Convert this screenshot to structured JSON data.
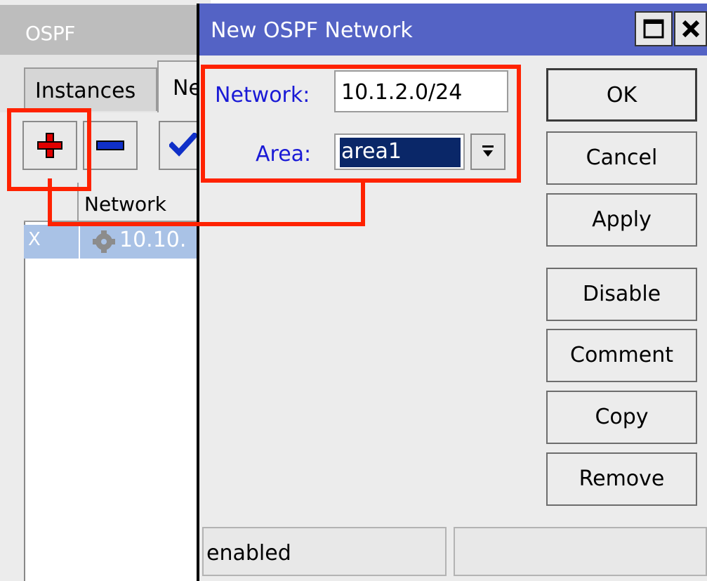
{
  "background_window": {
    "title": "OSPF",
    "tabs": [
      {
        "label": "Instances"
      },
      {
        "label": "Ne"
      }
    ],
    "toolbar": {
      "add_icon": "plus-icon",
      "remove_icon": "minus-icon",
      "enable_icon": "checkmark-icon"
    },
    "table": {
      "columns": [
        "",
        "Network"
      ],
      "rows": [
        {
          "flag": "X",
          "icon": "gear-icon",
          "network": "10.10."
        }
      ]
    }
  },
  "dialog": {
    "title": "New OSPF Network",
    "fields": {
      "network_label": "Network:",
      "network_value": "10.1.2.0/24",
      "area_label": "Area:",
      "area_value": "area1"
    },
    "buttons": {
      "ok": "OK",
      "cancel": "Cancel",
      "apply": "Apply",
      "disable": "Disable",
      "comment": "Comment",
      "copy": "Copy",
      "remove": "Remove"
    },
    "status": "enabled"
  },
  "colors": {
    "title_bar": "#5463c5",
    "label_text": "#1a1ad6",
    "highlight": "#ff2200",
    "selection": "#0a2768",
    "row_selected": "#a9c2e6"
  }
}
